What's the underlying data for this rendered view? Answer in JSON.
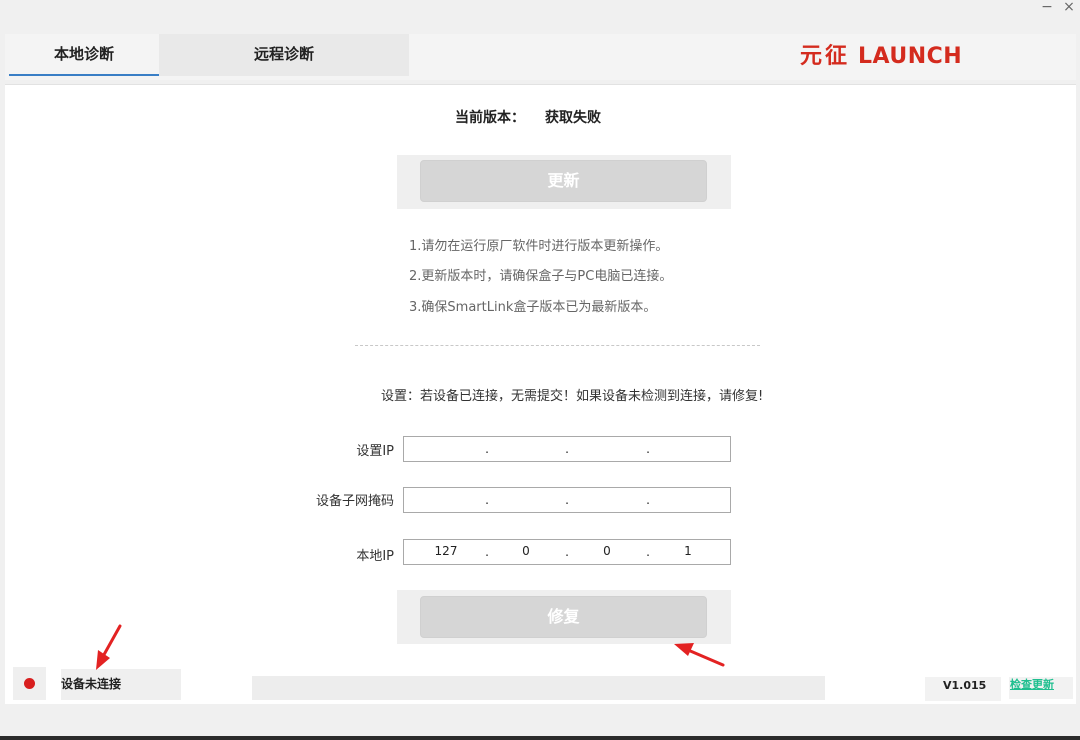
{
  "window": {
    "minimize_glyph": "−",
    "close_glyph": "×"
  },
  "tabs": [
    {
      "label": "本地诊断",
      "active": true
    },
    {
      "label": "远程诊断",
      "active": false
    }
  ],
  "brand": {
    "chinese": "元征",
    "english": "LAUNCH",
    "color": "#d42b1e"
  },
  "version": {
    "label": "当前版本：",
    "value": "获取失败"
  },
  "update_button": {
    "label": "更新"
  },
  "notes": [
    "1.请勿在运行原厂软件时进行版本更新操作。",
    "2.更新版本时，请确保盒子与PC电脑已连接。",
    "3.确保SmartLink盒子版本已为最新版本。"
  ],
  "settings_hint": "设置：若设备已连接，无需提交！如果设备未检测到连接，请修复!",
  "fields": {
    "device_ip": {
      "label": "设置IP",
      "segments": [
        "",
        "",
        "",
        ""
      ]
    },
    "subnet_mask": {
      "label": "设备子网掩码",
      "segments": [
        "",
        "",
        "",
        ""
      ]
    },
    "local_ip": {
      "label": "本地IP",
      "segments": [
        "127",
        "0",
        "0",
        "1"
      ]
    }
  },
  "repair_button": {
    "label": "修复"
  },
  "status": {
    "text": "设备未连接",
    "indicator_color": "#d81e1e"
  },
  "app_version": "V1.015",
  "check_update_link": "检查更新",
  "colors": {
    "tab_underline": "#3a7fc6",
    "check_update": "#1fbf8f",
    "annotation_arrow": "#e32222"
  }
}
